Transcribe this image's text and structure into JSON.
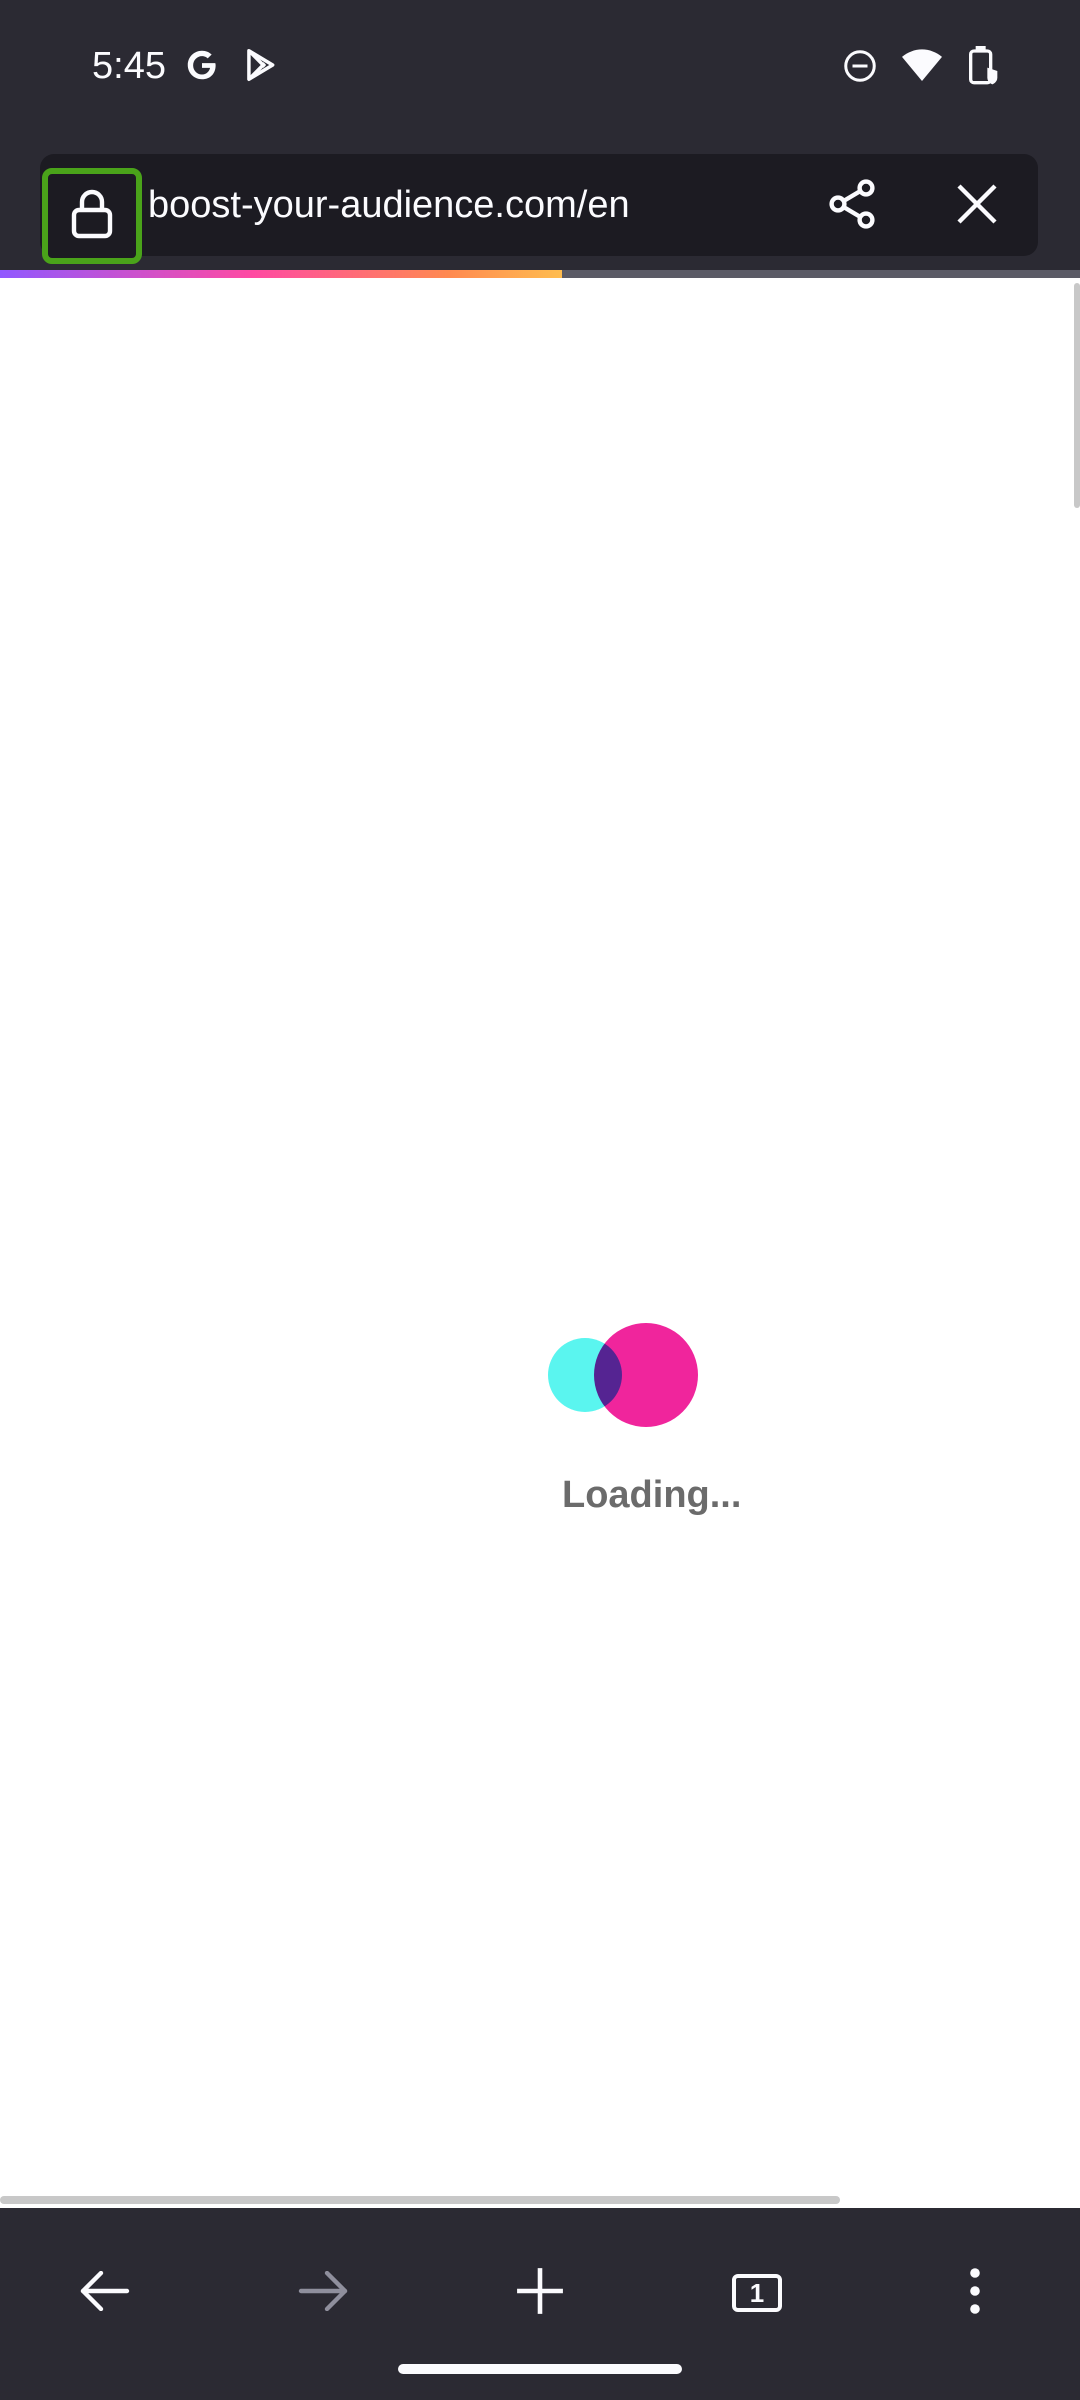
{
  "status": {
    "time": "5:45",
    "left_icons": [
      "google-g-icon",
      "play-store-icon"
    ],
    "right_icons": [
      "do-not-disturb-icon",
      "wifi-icon",
      "battery-saver-icon"
    ]
  },
  "toolbar": {
    "url": "boost-your-audience.com/en",
    "page_load_progress": 0.52
  },
  "page": {
    "loading_text": "Loading..."
  },
  "navbar": {
    "tab_count": "1"
  },
  "colors": {
    "chrome": "#2b2a33",
    "urlbar": "#1c1b22",
    "lock_highlight": "#4aa31a",
    "loader_cyan": "#5af5ef",
    "loader_pink": "#f0259c"
  }
}
